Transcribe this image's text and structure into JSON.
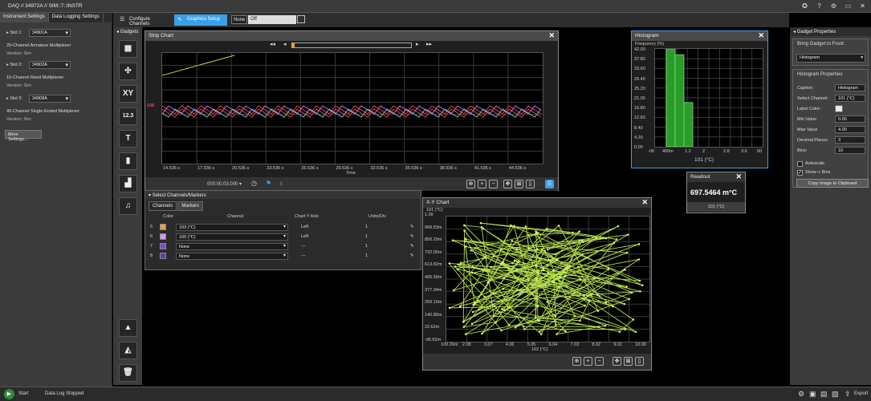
{
  "titlebar": {
    "title": "DAQ // 34972A // SIM::7::INSTR"
  },
  "left_panel": {
    "tabs": [
      "Instrument Settings",
      "Data Logging Settings"
    ],
    "slots": [
      {
        "label": "Slot 1:",
        "module": "34901A",
        "description": "20-Channel Armature Multiplexer",
        "version": "Version: Sim"
      },
      {
        "label": "Slot 2:",
        "module": "34902A",
        "description": "16-Channel Reed Multiplexer",
        "version": "Version: Sim"
      },
      {
        "label": "Slot 3:",
        "module": "34908A",
        "description": "40-Channel Single-Ended Multiplexer",
        "version": "Version: Sim"
      }
    ],
    "more_settings": "More Settings..."
  },
  "toolbar": {
    "configure_channels": "Configure Channels",
    "graphics_setup": "Graphics Setup",
    "none_label": "None",
    "off_value": "Off"
  },
  "gadgets": {
    "header": "Gadgets",
    "xy_label": "XY",
    "num_label": "12.3",
    "text_label": "T"
  },
  "strip_chart": {
    "title": "Strip Chart",
    "time_ticks": [
      "14.536 s",
      "17.536 s",
      "20.536 s",
      "23.536 s",
      "26.536 s",
      "29.536 s",
      "32.536 s",
      "35.536 s",
      "38.536 s",
      "41.536 s",
      "44.536 s"
    ],
    "x_label": "Time",
    "marker_label": "108",
    "time_value": "000:00:03.000",
    "colors": {
      "green": "#a7e23a",
      "red": "#e8455a",
      "cyan": "#5ad6d6",
      "pink": "#d070e0"
    }
  },
  "channels": {
    "header": "Select Channels/Markers",
    "tabs": [
      "Channels",
      "Markers"
    ],
    "columns": [
      "Color",
      "Channel",
      "Chart Y Axis",
      "Units/Div"
    ],
    "rows": [
      {
        "num": "5",
        "color": "#e8a040",
        "channel": "103 (°C)",
        "axis": "Left",
        "units": "1"
      },
      {
        "num": "6",
        "color": "#c8a0e8",
        "channel": "100 (°C)",
        "axis": "Left",
        "units": "1"
      },
      {
        "num": "7",
        "color": "#7a50c8",
        "channel": "None",
        "axis": "---",
        "units": "1"
      },
      {
        "num": "8",
        "color": "#6040b0",
        "channel": "None",
        "axis": "---",
        "units": "1"
      }
    ]
  },
  "histogram": {
    "title": "Histogram",
    "ylabel": "Frequency (%)",
    "y_ticks": [
      "42.00",
      "37.80",
      "33.60",
      "29.40",
      "25.20",
      "21.00",
      "16.80",
      "12.60",
      "8.40",
      "4.20",
      "0.00"
    ],
    "x_ticks": [
      "-00",
      "400m",
      "1.2",
      "2",
      "2.8",
      "3.6",
      "00"
    ],
    "xlabel": "101 (°C)",
    "chart_data": {
      "type": "bar",
      "categories": [
        "0.0-0.4",
        "0.4-0.8",
        "0.8-1.2"
      ],
      "values": [
        42.0,
        39.5,
        19.0
      ],
      "ylim": [
        0,
        42
      ]
    }
  },
  "readout": {
    "title": "Readout",
    "value": "697.5464 m°C",
    "channel": "101 (°C)"
  },
  "xy_chart": {
    "title": "X-Y Chart",
    "ylabel": "101 (°C)",
    "y_ticks": [
      "1.09",
      "968.53m",
      "850.29m",
      "732.05m",
      "613.82m",
      "495.58m",
      "377.34m",
      "259.10m",
      "140.86m",
      "22.62m",
      "-95.62m"
    ],
    "x_ticks": [
      "100.00m",
      "2.08",
      "3.07",
      "4.06",
      "5.05",
      "6.04",
      "7.03",
      "8.02",
      "9.01",
      "10.00"
    ],
    "xlabel": "102 (°C)",
    "line_color": "#b4e04a"
  },
  "gadget_properties": {
    "header": "Gadget Properties",
    "bring_front_label": "Bring Gadget to Front:",
    "bring_front_value": "Histogram",
    "hist_props_label": "Histogram Properties",
    "fields": [
      {
        "label": "Caption:",
        "value": "Histogram"
      },
      {
        "label": "Select Channel:",
        "value": "101 (°C)"
      },
      {
        "label": "Label Color:",
        "value": ""
      },
      {
        "label": "Min Value",
        "value": "0.00"
      },
      {
        "label": "Max Value",
        "value": "4.00"
      },
      {
        "label": "Decimal Places",
        "value": "3"
      },
      {
        "label": "Bins:",
        "value": "10"
      }
    ],
    "autoscale": "Autoscale",
    "show_bins": "Show ∞ Bins",
    "copy_image": "Copy Image to Clipboard"
  },
  "statusbar": {
    "start": "Start",
    "status": "Data Log Stopped",
    "export": "Export"
  }
}
